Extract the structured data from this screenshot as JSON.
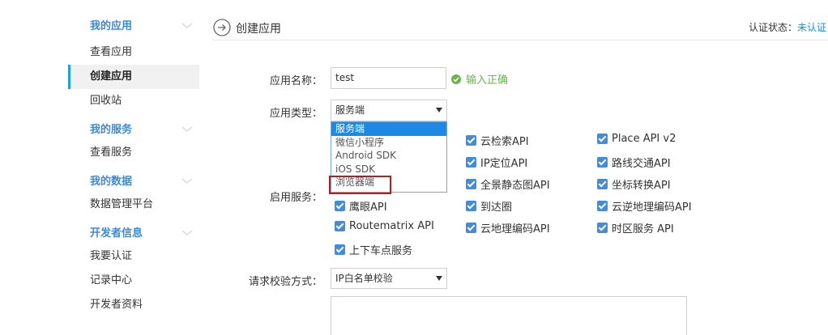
{
  "sidebar": {
    "sections": [
      {
        "title": "我的应用",
        "items": [
          "查看应用",
          "创建应用",
          "回收站"
        ]
      },
      {
        "title": "我的服务",
        "items": [
          "查看服务"
        ]
      },
      {
        "title": "我的数据",
        "items": [
          "数据管理平台"
        ]
      },
      {
        "title": "开发者信息",
        "items": [
          "我要认证",
          "记录中心",
          "开发者资料"
        ]
      }
    ],
    "active_item": "创建应用"
  },
  "header": {
    "title": "创建应用",
    "auth_label": "认证状态：",
    "auth_value": "未认证"
  },
  "form": {
    "app_name_label": "应用名称：",
    "app_name_value": "test",
    "app_name_ok": "输入正确",
    "app_type_label": "应用类型：",
    "app_type_value": "服务端",
    "app_type_options": [
      "服务端",
      "微信小程序",
      "Android SDK",
      "iOS SDK",
      "浏览器端"
    ],
    "services_label": "启用服务：",
    "services": [
      "云检索API",
      "Place API v2",
      "IP定位API",
      "路线交通API",
      "全景静态图API",
      "坐标转换API",
      "到达圈",
      "云逆地理编码API",
      "鹰眼API",
      "Routematrix API",
      "云地理编码API",
      "时区服务 API",
      "上下车点服务"
    ],
    "verify_label": "请求校验方式：",
    "verify_value": "IP白名单校验"
  },
  "colors": {
    "accent": "#1a8fd8",
    "sidebar_heading": "#3d8bd7",
    "checkbox": "#3f8ce0",
    "ok": "#6bb44a",
    "highlight": "#b01f24"
  }
}
